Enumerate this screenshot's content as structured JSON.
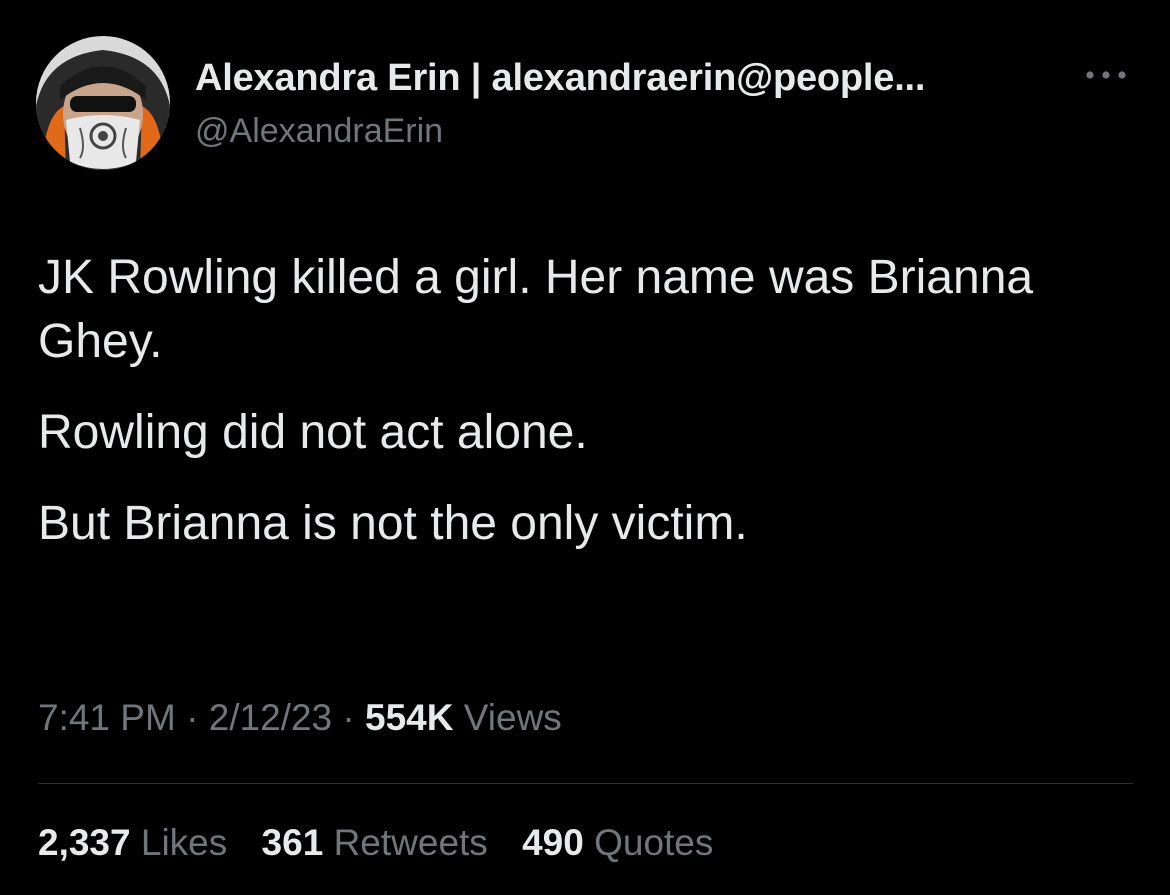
{
  "author": {
    "display_name": "Alexandra Erin | alexandraerin@people...",
    "handle": "@AlexandraErin",
    "avatar_icon": "masked-person-avatar"
  },
  "more_icon": "more-horizontal-icon",
  "tweet": {
    "paragraphs": [
      "JK Rowling killed a girl. Her name was Brianna Ghey.",
      "Rowling did not act alone.",
      "But Brianna is not the only victim."
    ]
  },
  "meta": {
    "time": "7:41 PM",
    "separator": "·",
    "date": "2/12/23",
    "views_count": "554K",
    "views_label": "Views"
  },
  "stats": {
    "likes_count": "2,337",
    "likes_label": "Likes",
    "retweets_count": "361",
    "retweets_label": "Retweets",
    "quotes_count": "490",
    "quotes_label": "Quotes"
  },
  "colors": {
    "background": "#000000",
    "primary_text": "#e7e9ea",
    "secondary_text": "#71767b",
    "divider": "#2f3336"
  }
}
